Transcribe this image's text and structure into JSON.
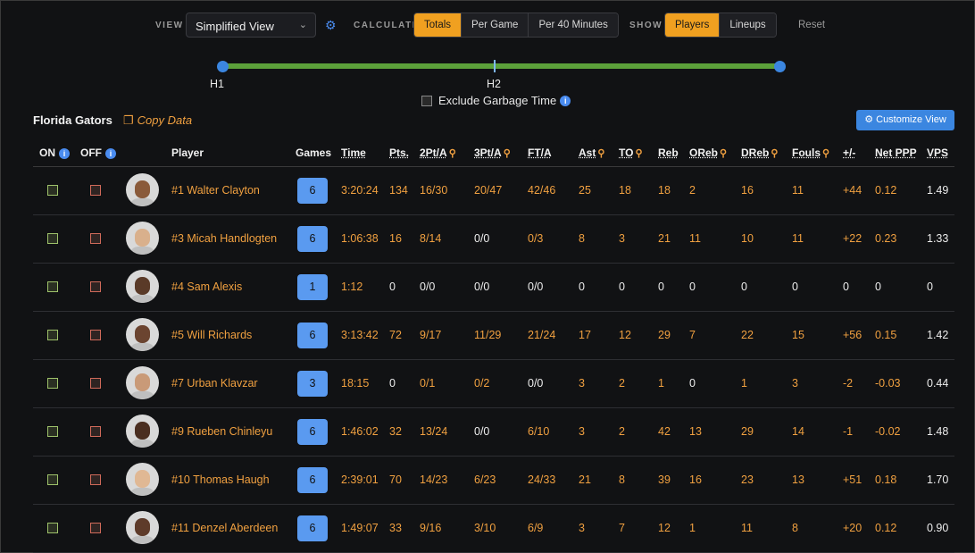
{
  "controls": {
    "view_label": "VIEW",
    "view_value": "Simplified View",
    "calculate_label": "CALCULATE",
    "calculate_options": [
      "Totals",
      "Per Game",
      "Per 40 Minutes"
    ],
    "show_label": "SHOW",
    "show_options": [
      "Players",
      "Lineups"
    ],
    "reset_label": "Reset"
  },
  "slider": {
    "h1_label": "H1",
    "h2_label": "H2",
    "garbage_label": "Exclude Garbage Time"
  },
  "team": {
    "name": "Florida Gators",
    "copy_label": "Copy Data",
    "customize_label": "Customize View"
  },
  "table": {
    "headers": {
      "on": "ON",
      "off": "OFF",
      "player": "Player",
      "games": "Games",
      "time": "Time",
      "pts": "Pts.",
      "two": "2Pt/A",
      "three": "3Pt/A",
      "ft": "FT/A",
      "ast": "Ast",
      "to": "TO",
      "reb": "Reb",
      "oreb": "OReb",
      "dreb": "DReb",
      "fouls": "Fouls",
      "pm": "+/-",
      "ppp": "Net PPP",
      "vps": "VPS"
    },
    "rows": [
      {
        "player": "#1 Walter Clayton",
        "games": "6",
        "time": "3:20:24",
        "pts": "134",
        "two": "16/30",
        "three": "20/47",
        "ft": "42/46",
        "ast": "25",
        "to": "18",
        "reb": "18",
        "oreb": "2",
        "dreb": "16",
        "fouls": "11",
        "pm": "+44",
        "ppp": "0.12",
        "vps": "1.49"
      },
      {
        "player": "#3 Micah Handlogten",
        "games": "6",
        "time": "1:06:38",
        "pts": "16",
        "two": "8/14",
        "three": "0/0",
        "ft": "0/3",
        "ast": "8",
        "to": "3",
        "reb": "21",
        "oreb": "11",
        "dreb": "10",
        "fouls": "11",
        "pm": "+22",
        "ppp": "0.23",
        "vps": "1.33"
      },
      {
        "player": "#4 Sam Alexis",
        "games": "1",
        "time": "1:12",
        "pts": "0",
        "two": "0/0",
        "three": "0/0",
        "ft": "0/0",
        "ast": "0",
        "to": "0",
        "reb": "0",
        "oreb": "0",
        "dreb": "0",
        "fouls": "0",
        "pm": "0",
        "ppp": "0",
        "vps": "0"
      },
      {
        "player": "#5 Will Richards",
        "games": "6",
        "time": "3:13:42",
        "pts": "72",
        "two": "9/17",
        "three": "11/29",
        "ft": "21/24",
        "ast": "17",
        "to": "12",
        "reb": "29",
        "oreb": "7",
        "dreb": "22",
        "fouls": "15",
        "pm": "+56",
        "ppp": "0.15",
        "vps": "1.42"
      },
      {
        "player": "#7 Urban Klavzar",
        "games": "3",
        "time": "18:15",
        "pts": "0",
        "two": "0/1",
        "three": "0/2",
        "ft": "0/0",
        "ast": "3",
        "to": "2",
        "reb": "1",
        "oreb": "0",
        "dreb": "1",
        "fouls": "3",
        "pm": "-2",
        "ppp": "-0.03",
        "vps": "0.44"
      },
      {
        "player": "#9 Rueben Chinleyu",
        "games": "6",
        "time": "1:46:02",
        "pts": "32",
        "two": "13/24",
        "three": "0/0",
        "ft": "6/10",
        "ast": "3",
        "to": "2",
        "reb": "42",
        "oreb": "13",
        "dreb": "29",
        "fouls": "14",
        "pm": "-1",
        "ppp": "-0.02",
        "vps": "1.48"
      },
      {
        "player": "#10 Thomas Haugh",
        "games": "6",
        "time": "2:39:01",
        "pts": "70",
        "two": "14/23",
        "three": "6/23",
        "ft": "24/33",
        "ast": "21",
        "to": "8",
        "reb": "39",
        "oreb": "16",
        "dreb": "23",
        "fouls": "13",
        "pm": "+51",
        "ppp": "0.18",
        "vps": "1.70"
      },
      {
        "player": "#11 Denzel Aberdeen",
        "games": "6",
        "time": "1:49:07",
        "pts": "33",
        "two": "9/16",
        "three": "3/10",
        "ft": "6/9",
        "ast": "3",
        "to": "7",
        "reb": "12",
        "oreb": "1",
        "dreb": "11",
        "fouls": "8",
        "pm": "+20",
        "ppp": "0.12",
        "vps": "0.90"
      }
    ]
  },
  "colors": {
    "accent_orange": "#f0a020",
    "accent_blue": "#3b86e0",
    "slider_green": "#5ca03a"
  }
}
